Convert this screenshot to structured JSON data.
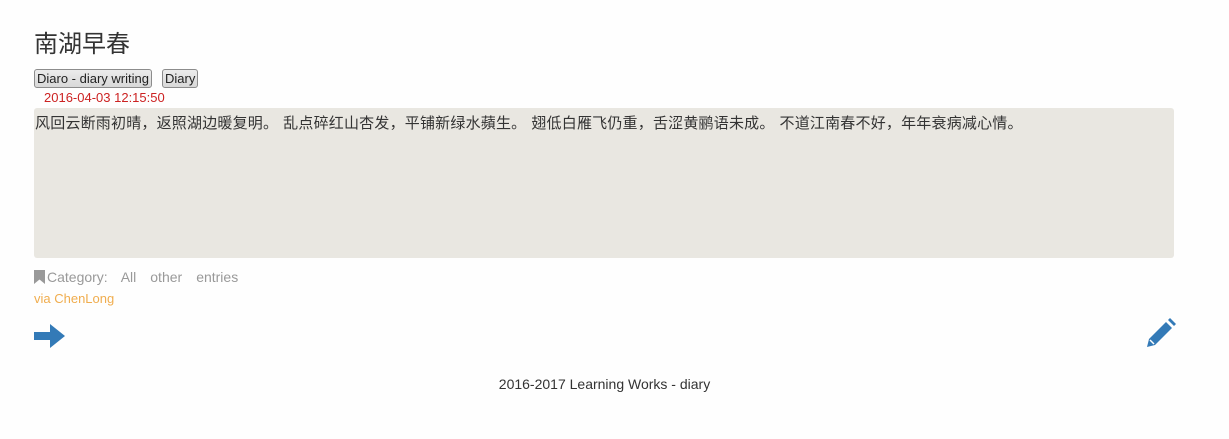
{
  "entry": {
    "title": "南湖早春",
    "tags": [
      "Diaro - diary writing",
      "Diary"
    ],
    "timestamp": "2016-04-03 12:15:50",
    "content": "风回云断雨初晴，返照湖边暖复明。 乱点碎红山杏发，平铺新绿水蘋生。 翅低白雁飞仍重，舌涩黄鹂语未成。 不道江南春不好，年年衰病减心情。",
    "category_label": "Category:",
    "categories": [
      "All",
      "other",
      "entries"
    ],
    "author": "via ChenLong"
  },
  "icons": {
    "bookmark": "bookmark-icon",
    "next": "arrow-right-icon",
    "edit": "pencil-icon"
  },
  "colors": {
    "timestamp": "#cc2222",
    "content_bg": "#e9e7e1",
    "author": "#f0ad4e",
    "icon_blue": "#337ab7"
  },
  "footer": {
    "text": "2016-2017 Learning Works - diary"
  }
}
